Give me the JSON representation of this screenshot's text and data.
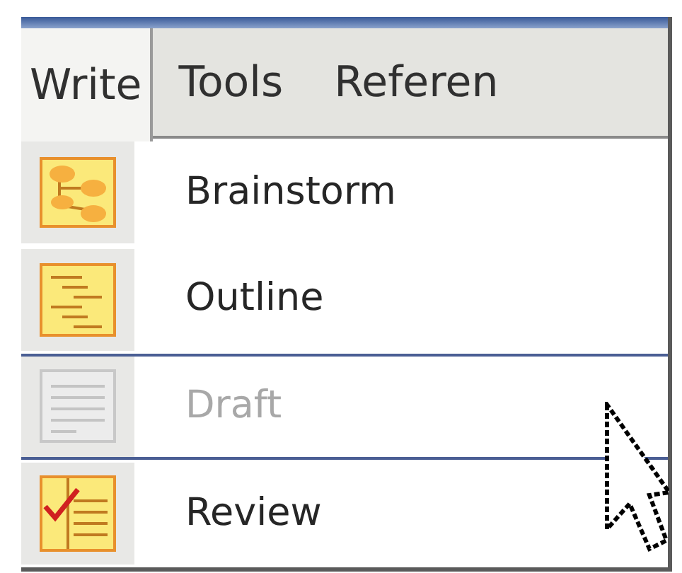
{
  "tabs": [
    {
      "label": "Write",
      "selected": true
    },
    {
      "label": "Tools",
      "selected": false
    },
    {
      "label": "Referen",
      "selected": false
    }
  ],
  "menu": [
    {
      "label": "Brainstorm",
      "kind": "brainstorm",
      "disabled": false,
      "highlighted": false
    },
    {
      "label": "Outline",
      "kind": "outline",
      "disabled": false,
      "highlighted": false
    },
    {
      "label": "Draft",
      "kind": "draft",
      "disabled": true,
      "highlighted": true
    },
    {
      "label": "Review",
      "kind": "review",
      "disabled": false,
      "highlighted": false
    }
  ]
}
